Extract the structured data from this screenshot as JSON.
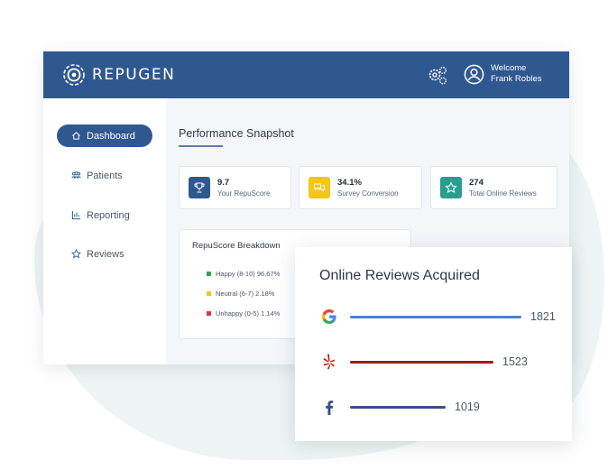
{
  "brand": {
    "name": "REPUGEN",
    "primary_color": "#2f5891"
  },
  "header": {
    "settings_icon": "gears-icon",
    "user_icon": "user-circle-icon",
    "welcome_label": "Welcome",
    "user_name": "Frank Robles"
  },
  "sidebar": {
    "items": [
      {
        "label": "Dashboard",
        "icon": "home-icon",
        "active": true
      },
      {
        "label": "Patients",
        "icon": "users-icon",
        "active": false
      },
      {
        "label": "Reporting",
        "icon": "bar-chart-icon",
        "active": false
      },
      {
        "label": "Reviews",
        "icon": "star-icon",
        "active": false
      }
    ]
  },
  "snapshot": {
    "title": "Performance Snapshot",
    "kpis": [
      {
        "value": "9.7",
        "label": "Your RepuScore",
        "icon": "trophy-icon",
        "color": "#2f5891"
      },
      {
        "value": "34.1%",
        "label": "Survey Conversion",
        "icon": "chat-icon",
        "color": "#f5c518"
      },
      {
        "value": "274",
        "label": "Total Online Reviews",
        "icon": "star-icon",
        "color": "#2a9d8f"
      }
    ]
  },
  "breakdown": {
    "title": "RepuScore Breakdown",
    "items": [
      {
        "label": "Happy (8-10) 96.67%",
        "color": "#2fa84f"
      },
      {
        "label": "Neutral (6-7) 2.18%",
        "color": "#f5c518"
      },
      {
        "label": "Unhappy (0-5) 1.14%",
        "color": "#e0393e"
      }
    ]
  },
  "reviews_card": {
    "title": "Online Reviews Acquired",
    "max": 1821,
    "rows": [
      {
        "source_icon": "google-icon",
        "count": 1821,
        "count_label": "1821",
        "color": "#4a7fd8"
      },
      {
        "source_icon": "yelp-icon",
        "count": 1523,
        "count_label": "1523",
        "color": "#a3161a"
      },
      {
        "source_icon": "facebook-icon",
        "count": 1019,
        "count_label": "1019",
        "color": "#354f8a"
      }
    ]
  }
}
